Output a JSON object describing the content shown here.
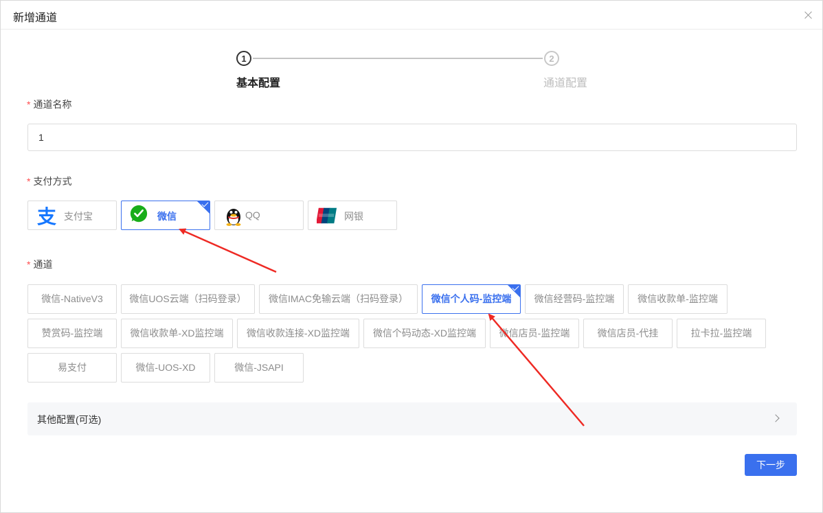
{
  "dialog": {
    "title": "新增通道"
  },
  "steps": [
    {
      "number": "1",
      "label": "基本配置",
      "state": "active"
    },
    {
      "number": "2",
      "label": "通道配置",
      "state": "inactive"
    }
  ],
  "channel_name": {
    "label": "通道名称",
    "required_mark": "*",
    "value": "1"
  },
  "payment_method": {
    "label": "支付方式",
    "required_mark": "*",
    "options": [
      {
        "label": "支付宝",
        "icon": "alipay-icon",
        "selected": false
      },
      {
        "label": "微信",
        "icon": "wechat-icon",
        "selected": true
      },
      {
        "label": "QQ",
        "icon": "qq-penguin-icon",
        "selected": false
      },
      {
        "label": "网银",
        "icon": "unionpay-icon",
        "selected": false
      }
    ]
  },
  "channel": {
    "label": "通道",
    "required_mark": "*",
    "options": [
      {
        "label": "微信-NativeV3",
        "selected": false
      },
      {
        "label": "微信UOS云端（扫码登录）",
        "selected": false
      },
      {
        "label": "微信IMAC免输云端（扫码登录）",
        "selected": false
      },
      {
        "label": "微信个人码-监控端",
        "selected": true
      },
      {
        "label": "微信经营码-监控端",
        "selected": false
      },
      {
        "label": "微信收款单-监控端",
        "selected": false
      },
      {
        "label": "赞赏码-监控端",
        "selected": false
      },
      {
        "label": "微信收款单-XD监控端",
        "selected": false
      },
      {
        "label": "微信收款连接-XD监控端",
        "selected": false
      },
      {
        "label": "微信个码动态-XD监控端",
        "selected": false
      },
      {
        "label": "微信店员-监控端",
        "selected": false
      },
      {
        "label": "微信店员-代挂",
        "selected": false
      },
      {
        "label": "拉卡拉-监控端",
        "selected": false
      },
      {
        "label": "易支付",
        "selected": false
      },
      {
        "label": "微信-UOS-XD",
        "selected": false
      },
      {
        "label": "微信-JSAPI",
        "selected": false
      }
    ]
  },
  "other_config": {
    "label": "其他配置(可选)",
    "expanded": false
  },
  "footer": {
    "next_label": "下一步"
  },
  "colors": {
    "primary": "#3a70ee",
    "required": "#ff4d4f",
    "annotation_arrow": "#ee2a24"
  }
}
